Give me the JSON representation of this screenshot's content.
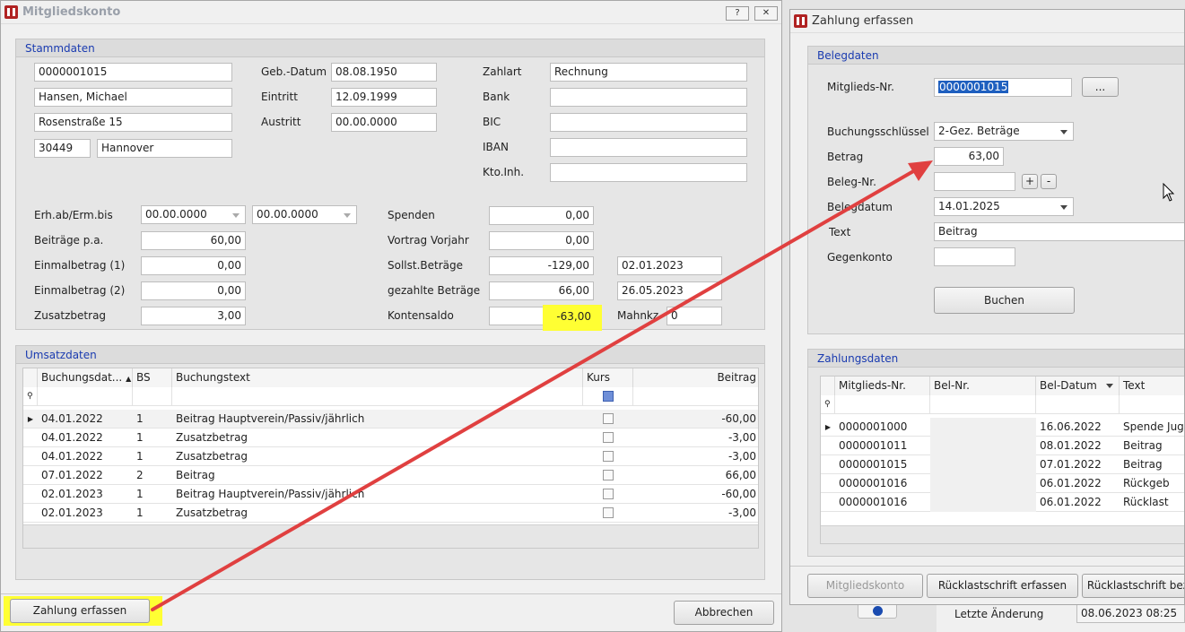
{
  "left_window": {
    "title": "Mitgliedskonto",
    "help_btn": "?",
    "close_btn": "✕",
    "stammdaten": {
      "header": "Stammdaten",
      "member_no": "0000001015",
      "name": "Hansen, Michael",
      "street": "Rosenstraße 15",
      "zip": "30449",
      "city": "Hannover",
      "geb_label": "Geb.-Datum",
      "geb_value": "08.08.1950",
      "eintritt_label": "Eintritt",
      "eintritt_value": "12.09.1999",
      "austritt_label": "Austritt",
      "austritt_value": "00.00.0000",
      "zahlart_label": "Zahlart",
      "zahlart_value": "Rechnung",
      "bank_label": "Bank",
      "bic_label": "BIC",
      "iban_label": "IBAN",
      "ktoinh_label": "Kto.Inh.",
      "erh_label": "Erh.ab/Erm.bis",
      "erh_from": "00.00.0000",
      "erh_to": "00.00.0000",
      "beitraege_label": "Beiträge p.a.",
      "beitraege_value": "60,00",
      "einmal1_label": "Einmalbetrag (1)",
      "einmal1_value": "0,00",
      "einmal2_label": "Einmalbetrag (2)",
      "einmal2_value": "0,00",
      "zusatz_label": "Zusatzbetrag",
      "zusatz_value": "3,00",
      "spenden_label": "Spenden",
      "spenden_value": "0,00",
      "vortrag_label": "Vortrag Vorjahr",
      "vortrag_value": "0,00",
      "sollst_label": "Sollst.Beträge",
      "sollst_value": "-129,00",
      "sollst_date": "02.01.2023",
      "gezahlt_label": "gezahlte Beträge",
      "gezahlt_value": "66,00",
      "gezahlt_date": "26.05.2023",
      "saldo_label": "Kontensaldo",
      "saldo_value": "-63,00",
      "mahnkz_label": "Mahnkz",
      "mahnkz_value": "0"
    },
    "umsatz": {
      "header": "Umsatzdaten",
      "columns": [
        "Buchungsdat...",
        "BS",
        "Buchungstext",
        "Kurs",
        "Beitrag"
      ],
      "rows": [
        {
          "date": "04.01.2022",
          "bs": "1",
          "text": "Beitrag Hauptverein/Passiv/jährlich",
          "amount": "-60,00"
        },
        {
          "date": "04.01.2022",
          "bs": "1",
          "text": "Zusatzbetrag",
          "amount": "-3,00"
        },
        {
          "date": "04.01.2022",
          "bs": "1",
          "text": "Zusatzbetrag",
          "amount": "-3,00"
        },
        {
          "date": "07.01.2022",
          "bs": "2",
          "text": "Beitrag",
          "amount": "66,00"
        },
        {
          "date": "02.01.2023",
          "bs": "1",
          "text": "Beitrag Hauptverein/Passiv/jährlich",
          "amount": "-60,00"
        },
        {
          "date": "02.01.2023",
          "bs": "1",
          "text": "Zusatzbetrag",
          "amount": "-3,00"
        }
      ]
    },
    "btn_zahlung": "Zahlung erfassen",
    "btn_abbrechen": "Abbrechen"
  },
  "right_window": {
    "title": "Zahlung erfassen",
    "beleg": {
      "header": "Belegdaten",
      "mitglied_label": "Mitglieds-Nr.",
      "mitglied_value": "0000001015",
      "browse_btn": "...",
      "schluessel_label": "Buchungsschlüssel",
      "schluessel_value": "2-Gez. Beträge",
      "betrag_label": "Betrag",
      "betrag_value": "63,00",
      "belegnr_label": "Beleg-Nr.",
      "plus": "+",
      "minus": "-",
      "belegdatum_label": "Belegdatum",
      "belegdatum_value": "14.01.2025",
      "text_label": "Text",
      "text_value": "Beitrag",
      "gegenkonto_label": "Gegenkonto",
      "buchen_btn": "Buchen"
    },
    "zahlung": {
      "header": "Zahlungsdaten",
      "columns": [
        "Mitglieds-Nr.",
        "Bel-Nr.",
        "Bel-Datum",
        "Text"
      ],
      "rows": [
        {
          "nr": "0000001000",
          "bel": "",
          "date": "16.06.2022",
          "text": "Spende Juge"
        },
        {
          "nr": "0000001011",
          "bel": "",
          "date": "08.01.2022",
          "text": "Beitrag"
        },
        {
          "nr": "0000001015",
          "bel": "",
          "date": "07.01.2022",
          "text": "Beitrag"
        },
        {
          "nr": "0000001016",
          "bel": "",
          "date": "06.01.2022",
          "text": "Rückgeb"
        },
        {
          "nr": "0000001016",
          "bel": "",
          "date": "06.01.2022",
          "text": "Rücklast"
        }
      ]
    },
    "btn_mitgliedskonto": "Mitgliedskonto",
    "btn_ruecklast": "Rücklastschrift erfassen",
    "btn_ruecklast2": "Rücklastschrift bez"
  },
  "background": {
    "letzte_label": "Letzte Änderung",
    "letzte_value": "08.06.2023 08:25"
  },
  "colors": {
    "highlight": "#ffff33",
    "arrow": "#e04040",
    "group_header": "#1a3bb0"
  }
}
